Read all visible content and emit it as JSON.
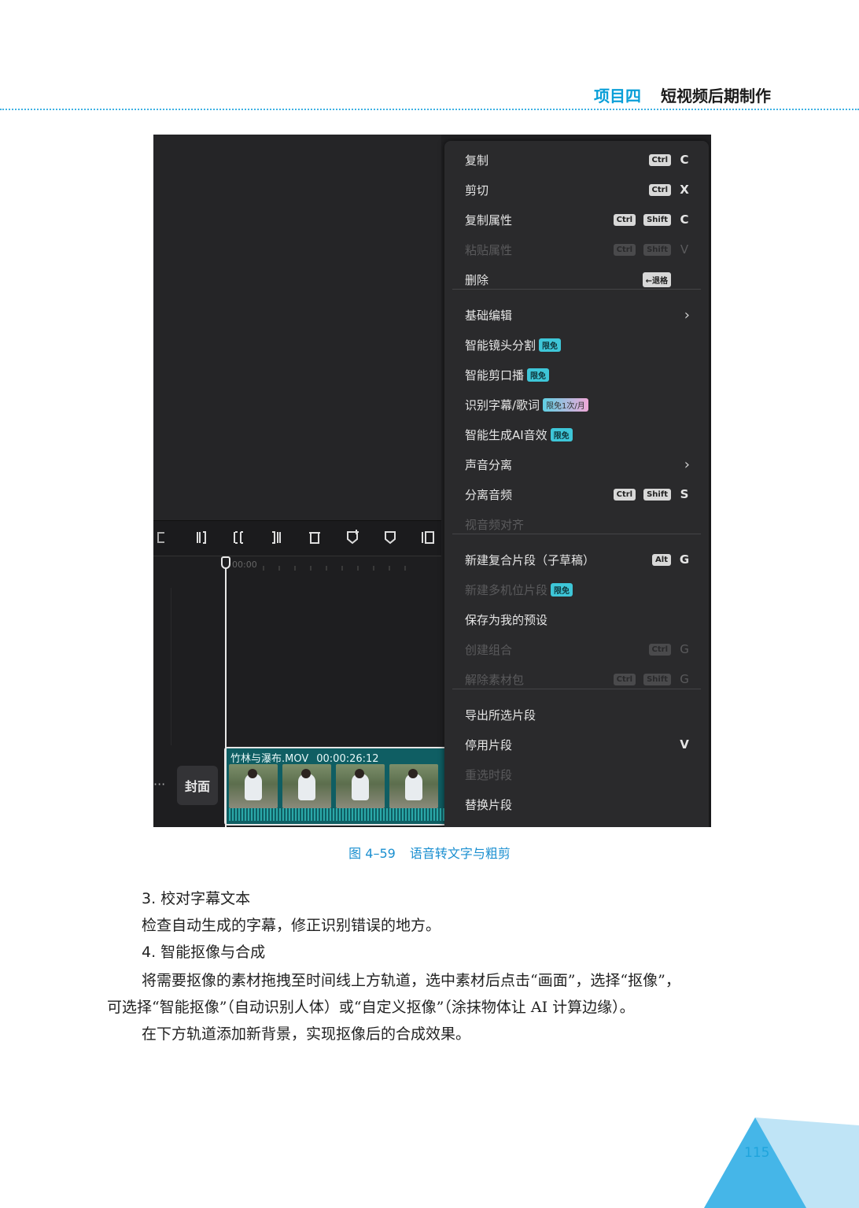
{
  "header": {
    "project": "项目四",
    "chapter": "短视频后期制作"
  },
  "timeline": {
    "ruler_time": "00:00",
    "more": "···",
    "cover": "封面",
    "clip_name": "竹林与瀑布.MOV",
    "clip_duration": "00:00:26:12"
  },
  "menu": {
    "items": [
      {
        "label": "复制",
        "keys": [
          "Ctrl"
        ],
        "letter": "C"
      },
      {
        "label": "剪切",
        "keys": [
          "Ctrl"
        ],
        "letter": "X"
      },
      {
        "label": "复制属性",
        "keys": [
          "Ctrl",
          "Shift"
        ],
        "letter": "C"
      },
      {
        "label": "粘贴属性",
        "keys": [
          "Ctrl",
          "Shift"
        ],
        "letter": "V",
        "disabled": true
      },
      {
        "label": "删除",
        "keys": [
          "←退格"
        ],
        "letter": ""
      },
      {
        "label": "基础编辑",
        "submenu": true
      },
      {
        "label": "智能镜头分割",
        "badge": "限免"
      },
      {
        "label": "智能剪口播",
        "badge": "限免"
      },
      {
        "label": "识别字幕/歌词",
        "badge": "限免1次/月"
      },
      {
        "label": "智能生成AI音效",
        "badge": "限免"
      },
      {
        "label": "声音分离",
        "submenu": true
      },
      {
        "label": "分离音频",
        "keys": [
          "Ctrl",
          "Shift"
        ],
        "letter": "S"
      },
      {
        "label": "视音频对齐",
        "disabled": true
      },
      {
        "label": "新建复合片段（子草稿）",
        "keys": [
          "Alt"
        ],
        "letter": "G"
      },
      {
        "label": "新建多机位片段",
        "badge": "限免",
        "disabled": true
      },
      {
        "label": "保存为我的预设"
      },
      {
        "label": "创建组合",
        "keys": [
          "Ctrl"
        ],
        "letter": "G",
        "disabled": true
      },
      {
        "label": "解除素材包",
        "keys": [
          "Ctrl",
          "Shift"
        ],
        "letter": "G",
        "disabled": true
      },
      {
        "label": "导出所选片段"
      },
      {
        "label": "停用片段",
        "letter": "V"
      },
      {
        "label": "重选时段",
        "disabled": true
      },
      {
        "label": "替换片段"
      }
    ]
  },
  "figure": {
    "number": "图 4–59",
    "title": "语音转文字与粗剪"
  },
  "sections": {
    "s3_title": "3. 校对字幕文本",
    "s3_text": "检查自动生成的字幕，修正识别错误的地方。",
    "s4_title": "4. 智能抠像与合成",
    "s4_line1": "将需要抠像的素材拖拽至时间线上方轨道，选中素材后点击“画面”，选择“抠像”，",
    "s4_line2": "可选择“智能抠像”（自动识别人体）或“自定义抠像”（涂抹物体让 AI 计算边缘）。",
    "s4_line3": "在下方轨道添加新背景，实现抠像后的合成效果。"
  },
  "page_number": "115"
}
